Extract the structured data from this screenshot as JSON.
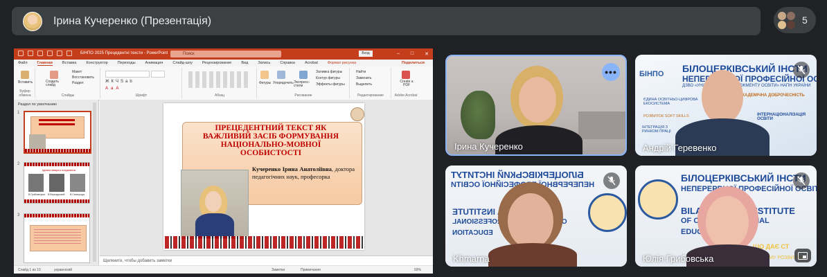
{
  "topbar": {
    "presenter_title": "Ірина Кучеренко (Презентація)"
  },
  "people": {
    "count": "5"
  },
  "powerpoint": {
    "window_title": "БІНПО 2025 Прецедентні тексти - PowerPoint",
    "search_placeholder": "Поиск",
    "login": "Вход",
    "menu": [
      "Файл",
      "Главная",
      "Вставка",
      "Конструктор",
      "Переходы",
      "Анимация",
      "Слайд-шоу",
      "Рецензирование",
      "Вид",
      "Запись",
      "Справка",
      "Acrobat",
      "Формат рисунка"
    ],
    "share": "Поделиться",
    "ribbon_groups": [
      "Буфер обмена",
      "Слайды",
      "Шрифт",
      "Абзац",
      "Рисование",
      "Редактирование",
      "Adobe Acrobat"
    ],
    "ribbon_items": {
      "paste": "Вставить",
      "new_slide": "Создать слайд",
      "layout": "Макет",
      "reset": "Восстановить",
      "section": "Раздел",
      "shapes": "Фигуры",
      "arrange": "Упорядочить",
      "quick_styles": "Экспресс-стили",
      "shape_fill": "Заливка фигуры",
      "shape_outline": "Контур фигуры",
      "shape_effects": "Эффекты фигуры",
      "find": "Найти",
      "replace": "Заменить",
      "select": "Выделить",
      "create_pdf": "Create a PDF"
    },
    "section_label": "Раздел по умолчанию",
    "slide_numbers": [
      "1",
      "2",
      "3"
    ],
    "thumb2_heading": "Ідеали вищого поєднання",
    "thumb2_captions": [
      "В.Грабовецька",
      "В.Вернадський",
      "В.Сковорода"
    ],
    "slide": {
      "title": "ПРЕЦЕДЕНТНИЙ ТЕКСТ ЯК ВАЖЛИВИЙ ЗАСІБ ФОРМУВАННЯ НАЦІОНАЛЬНО-МОВНОЇ ОСОБИСТОСТІ",
      "author_name": "Кучеренко Ірина Анатоліївна",
      "author_degree": ", доктора педагогічних наук, професорка"
    },
    "notes_placeholder": "Щелкните, чтобы добавить заметки",
    "status_slide": "Слайд 1 из 10",
    "status_lang": "украинский",
    "status_notes": "Заметки",
    "status_comments": "Примечания",
    "zoom": "69%"
  },
  "tiles": [
    {
      "name": "Ірина Кучеренко"
    },
    {
      "name": "Андрій Геревенко"
    },
    {
      "name": "Khmarna"
    },
    {
      "name": "Юлія Грибовська"
    }
  ],
  "banners": {
    "andriy": {
      "logo": "БІНПО",
      "line1": "БІЛОЦЕРКІВСЬКИЙ ІНСТИ",
      "line2": "НЕПЕРЕРВНОЇ ПРОФЕСІЙНОЇ ОСВІТИ",
      "line3": "ДЗВО «УНІВЕРСИТЕТ МЕНЕДЖМЕНТУ ОСВІТИ» НАПН УКРАЇНИ",
      "line4": "АКАДЕМІЧНА ДОБРОЧЕСНІСТЬ",
      "tag1": "ЄДИНА ОСВІТНЬО-ЦИФРОВА ЕКОСИСТЕМА",
      "tag2": "РОЗВИТОК SOFT SKILLS",
      "tag3": "ІНТЕГРАЦІЯ З РИНКОМ ПРАЦІ",
      "tag4": "ІНТЕРНАЦІОНАЛІЗАЦІЯ ОСВІТИ"
    },
    "khmarna": {
      "line1": "БІЛОЦЕРКІВСЬКИЙ ІНСТИТУТ",
      "line2": "НЕПЕРЕРВНОЇ ПРОФЕСІЙНОЇ ОСВІТИ",
      "line3": "BILA TSERKVA INSTITUTE",
      "line4": "OF CONTINUOUS PROFESSIONAL",
      "line5": "EDUCATION"
    },
    "yulia": {
      "line1": "БІЛОЦЕРКІВСЬКИЙ ІНСТИ",
      "line2": "НЕПЕРЕРВНОЇ ПРОФЕСІЙНОЇ ОСВІТИ",
      "line3": "BILA TSERKVA INSTITUTE",
      "line4": "OF CO       OFESSIONAL",
      "line5": "EDUC",
      "line6": "ЩО ДАЄ СТ",
      "line7": "СЬКОМУ РОЗВИТКУ"
    }
  },
  "colors": {
    "background": "#202124",
    "panel": "#3c4043",
    "active_border": "#8ab4f8",
    "ppt_red": "#c43e1c",
    "slide_title": "#c00000"
  },
  "icons": {
    "mic_off": "mic-off-icon",
    "more": "more-options-icon",
    "pip": "picture-in-picture-icon"
  }
}
